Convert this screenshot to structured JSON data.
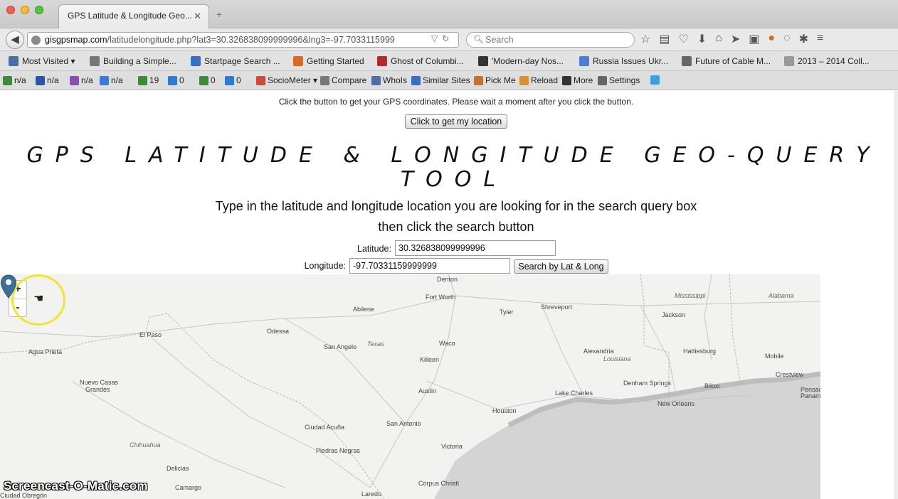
{
  "browser": {
    "tab_title": "GPS Latitude & Longitude Geo...",
    "tab_close": "✕",
    "new_tab": "+",
    "url_domain": "gisgpsmap.com",
    "url_path": "/latitudelongitude.php?lat3=30.326838099999996&lng3=-97.7033115999",
    "search_placeholder": "Search"
  },
  "bookmarks": [
    {
      "label": "Most Visited ▾",
      "color": "#4a6fa5"
    },
    {
      "label": "Building a Simple...",
      "color": "#777777"
    },
    {
      "label": "Startpage Search ...",
      "color": "#3b6cc4"
    },
    {
      "label": "Getting Started",
      "color": "#d86b1f"
    },
    {
      "label": "Ghost of Columbi...",
      "color": "#b52a2a"
    },
    {
      "label": "'Modern-day Nos...",
      "color": "#333333"
    },
    {
      "label": "Russia Issues Ukr...",
      "color": "#4b7fd1"
    },
    {
      "label": "Future of Cable M...",
      "color": "#666666"
    },
    {
      "label": "2013 – 2014 Coll...",
      "color": "#999999"
    }
  ],
  "seobar": [
    {
      "label": "n/a",
      "color": "#3a8a3a"
    },
    {
      "label": "n/a",
      "color": "#2b55a8"
    },
    {
      "label": "n/a",
      "color": "#8a4fb0"
    },
    {
      "label": "n/a",
      "color": "#3c7bd8"
    },
    {
      "label": "19",
      "color": "#3a8a3a"
    },
    {
      "label": "0",
      "color": "#2b7cd3"
    },
    {
      "label": "0",
      "color": "#3a8a3a"
    },
    {
      "label": "0",
      "color": "#2b7cd3"
    },
    {
      "label": "SocioMeter ▾",
      "color": "#d04a3a"
    },
    {
      "label": "Compare",
      "color": "#777777"
    },
    {
      "label": "WhoIs",
      "color": "#4a6fa5"
    },
    {
      "label": "Similar Sites",
      "color": "#3b6cc4"
    },
    {
      "label": "Pick Me",
      "color": "#c9702a"
    },
    {
      "label": "Reload",
      "color": "#d8902a"
    },
    {
      "label": "More",
      "color": "#333333"
    },
    {
      "label": "Settings",
      "color": "#666666"
    },
    {
      "label": "",
      "color": "#3aa0e0"
    }
  ],
  "page": {
    "intro": "Click the button to get your GPS coordinates. Please wait a moment after you click the button.",
    "location_button": "Click to get my location",
    "title": "GPS LATITUDE & LONGITUDE GEO-QUERY TOOL",
    "instruction_line1": "Type in the latitude and longitude location you are looking for in the search query box",
    "instruction_line2": "then click the search button",
    "latitude_label": "Latitude:",
    "latitude_value": "30.326838099999996",
    "longitude_label": "Longitude:",
    "longitude_value": "-97.70331159999999",
    "search_button": "Search by Lat & Long"
  },
  "map": {
    "zoom_in": "+",
    "zoom_out": "-",
    "labels": [
      {
        "text": "Denton"
      },
      {
        "text": "Fort Worth"
      },
      {
        "text": "Abilene"
      },
      {
        "text": "Tyler"
      },
      {
        "text": "Shreveport"
      },
      {
        "text": "Mississippi",
        "italic": true
      },
      {
        "text": "Alabama",
        "italic": true
      },
      {
        "text": "Jackson"
      },
      {
        "text": "El Paso"
      },
      {
        "text": "Odessa"
      },
      {
        "text": "San Angelo"
      },
      {
        "text": "Texas",
        "italic": true
      },
      {
        "text": "Waco"
      },
      {
        "text": "Killeen"
      },
      {
        "text": "Alexandria"
      },
      {
        "text": "Hattiesburg"
      },
      {
        "text": "Agua Prieta"
      },
      {
        "text": "Louisiana",
        "italic": true
      },
      {
        "text": "Mobile"
      },
      {
        "text": "Crestview"
      },
      {
        "text": "Nuevo Casas"
      },
      {
        "text": "Grandes"
      },
      {
        "text": "Austin"
      },
      {
        "text": "Lake Charles"
      },
      {
        "text": "Denham Springs"
      },
      {
        "text": "Biloxi"
      },
      {
        "text": "Pensacola"
      },
      {
        "text": "Panama"
      },
      {
        "text": "Houston"
      },
      {
        "text": "New Orleans"
      },
      {
        "text": "San Antonio"
      },
      {
        "text": "Ciudad Acuña"
      },
      {
        "text": "Chihuahua",
        "italic": true
      },
      {
        "text": "Piedras Negras"
      },
      {
        "text": "Victoria"
      },
      {
        "text": "Delicias"
      },
      {
        "text": "Camargo"
      },
      {
        "text": "Corpus Christi"
      },
      {
        "text": "Laredo"
      },
      {
        "text": "Ciudad Obregón"
      }
    ]
  },
  "watermark": "Screencast-O-Matic.com"
}
